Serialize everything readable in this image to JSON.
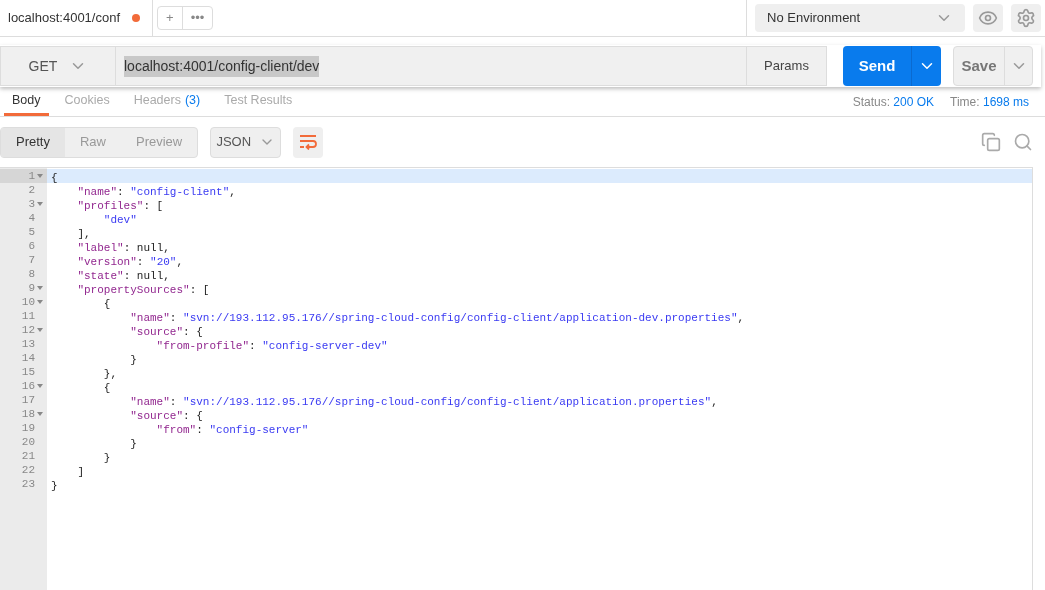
{
  "request_tabs": [
    {
      "label": "localhost:4001/conf",
      "unsaved": true
    }
  ],
  "tab_actions": [
    "+",
    "•••"
  ],
  "environment": {
    "value": "No Environment"
  },
  "request": {
    "method": "GET",
    "url": "localhost:4001/config-client/dev",
    "params": "Params",
    "send": "Send",
    "save": "Save"
  },
  "response_tabs": [
    {
      "label": "Body",
      "selected": true
    },
    {
      "label": "Cookies",
      "selected": false
    },
    {
      "label": "Headers",
      "count": "(3)",
      "selected": false
    },
    {
      "label": "Test Results",
      "selected": false
    }
  ],
  "status": {
    "label": "Status:",
    "value": "200 OK",
    "time_label": "Time:",
    "time_value": "1698 ms"
  },
  "view_modes": [
    {
      "label": "Pretty",
      "selected": true
    },
    {
      "label": "Raw",
      "selected": false
    },
    {
      "label": "Preview",
      "selected": false
    }
  ],
  "format": {
    "value": "JSON"
  },
  "wrap": {
    "on": true
  },
  "code_lines": [
    {
      "number": "1",
      "fold": true,
      "selected": true,
      "tokens": [
        {
          "kind": "punct",
          "text": "{"
        }
      ]
    },
    {
      "number": "2",
      "fold": false,
      "selected": false,
      "tokens": [
        {
          "kind": "key",
          "text": "    \"name\""
        },
        {
          "kind": "punct",
          "text": ": "
        },
        {
          "kind": "string",
          "text": "\"config-client\""
        },
        {
          "kind": "punct",
          "text": ","
        }
      ]
    },
    {
      "number": "3",
      "fold": true,
      "selected": false,
      "tokens": [
        {
          "kind": "key",
          "text": "    \"profiles\""
        },
        {
          "kind": "punct",
          "text": ": ["
        }
      ]
    },
    {
      "number": "4",
      "fold": false,
      "selected": false,
      "tokens": [
        {
          "kind": "string",
          "text": "        \"dev\""
        }
      ]
    },
    {
      "number": "5",
      "fold": false,
      "selected": false,
      "tokens": [
        {
          "kind": "punct",
          "text": "    ],"
        }
      ]
    },
    {
      "number": "6",
      "fold": false,
      "selected": false,
      "tokens": [
        {
          "kind": "key",
          "text": "    \"label\""
        },
        {
          "kind": "punct",
          "text": ": null,"
        }
      ]
    },
    {
      "number": "7",
      "fold": false,
      "selected": false,
      "tokens": [
        {
          "kind": "key",
          "text": "    \"version\""
        },
        {
          "kind": "punct",
          "text": ": "
        },
        {
          "kind": "string",
          "text": "\"20\""
        },
        {
          "kind": "punct",
          "text": ","
        }
      ]
    },
    {
      "number": "8",
      "fold": false,
      "selected": false,
      "tokens": [
        {
          "kind": "key",
          "text": "    \"state\""
        },
        {
          "kind": "punct",
          "text": ": null,"
        }
      ]
    },
    {
      "number": "9",
      "fold": true,
      "selected": false,
      "tokens": [
        {
          "kind": "key",
          "text": "    \"propertySources\""
        },
        {
          "kind": "punct",
          "text": ": ["
        }
      ]
    },
    {
      "number": "10",
      "fold": true,
      "selected": false,
      "tokens": [
        {
          "kind": "punct",
          "text": "        {"
        }
      ]
    },
    {
      "number": "11",
      "fold": false,
      "selected": false,
      "tokens": [
        {
          "kind": "key",
          "text": "            \"name\""
        },
        {
          "kind": "punct",
          "text": ": "
        },
        {
          "kind": "string",
          "text": "\"svn://193.112.95.176//spring-cloud-config/config-client/application-dev.properties\""
        },
        {
          "kind": "punct",
          "text": ","
        }
      ]
    },
    {
      "number": "12",
      "fold": true,
      "selected": false,
      "tokens": [
        {
          "kind": "key",
          "text": "            \"source\""
        },
        {
          "kind": "punct",
          "text": ": {"
        }
      ]
    },
    {
      "number": "13",
      "fold": false,
      "selected": false,
      "tokens": [
        {
          "kind": "key",
          "text": "                \"from-profile\""
        },
        {
          "kind": "punct",
          "text": ": "
        },
        {
          "kind": "string",
          "text": "\"config-server-dev\""
        }
      ]
    },
    {
      "number": "14",
      "fold": false,
      "selected": false,
      "tokens": [
        {
          "kind": "punct",
          "text": "            }"
        }
      ]
    },
    {
      "number": "15",
      "fold": false,
      "selected": false,
      "tokens": [
        {
          "kind": "punct",
          "text": "        },"
        }
      ]
    },
    {
      "number": "16",
      "fold": true,
      "selected": false,
      "tokens": [
        {
          "kind": "punct",
          "text": "        {"
        }
      ]
    },
    {
      "number": "17",
      "fold": false,
      "selected": false,
      "tokens": [
        {
          "kind": "key",
          "text": "            \"name\""
        },
        {
          "kind": "punct",
          "text": ": "
        },
        {
          "kind": "string",
          "text": "\"svn://193.112.95.176//spring-cloud-config/config-client/application.properties\""
        },
        {
          "kind": "punct",
          "text": ","
        }
      ]
    },
    {
      "number": "18",
      "fold": true,
      "selected": false,
      "tokens": [
        {
          "kind": "key",
          "text": "            \"source\""
        },
        {
          "kind": "punct",
          "text": ": {"
        }
      ]
    },
    {
      "number": "19",
      "fold": false,
      "selected": false,
      "tokens": [
        {
          "kind": "key",
          "text": "                \"from\""
        },
        {
          "kind": "punct",
          "text": ": "
        },
        {
          "kind": "string",
          "text": "\"config-server\""
        }
      ]
    },
    {
      "number": "20",
      "fold": false,
      "selected": false,
      "tokens": [
        {
          "kind": "punct",
          "text": "            }"
        }
      ]
    },
    {
      "number": "21",
      "fold": false,
      "selected": false,
      "tokens": [
        {
          "kind": "punct",
          "text": "        }"
        }
      ]
    },
    {
      "number": "22",
      "fold": false,
      "selected": false,
      "tokens": [
        {
          "kind": "punct",
          "text": "    ]"
        }
      ]
    },
    {
      "number": "23",
      "fold": false,
      "selected": false,
      "tokens": [
        {
          "kind": "punct",
          "text": "}"
        }
      ]
    }
  ]
}
